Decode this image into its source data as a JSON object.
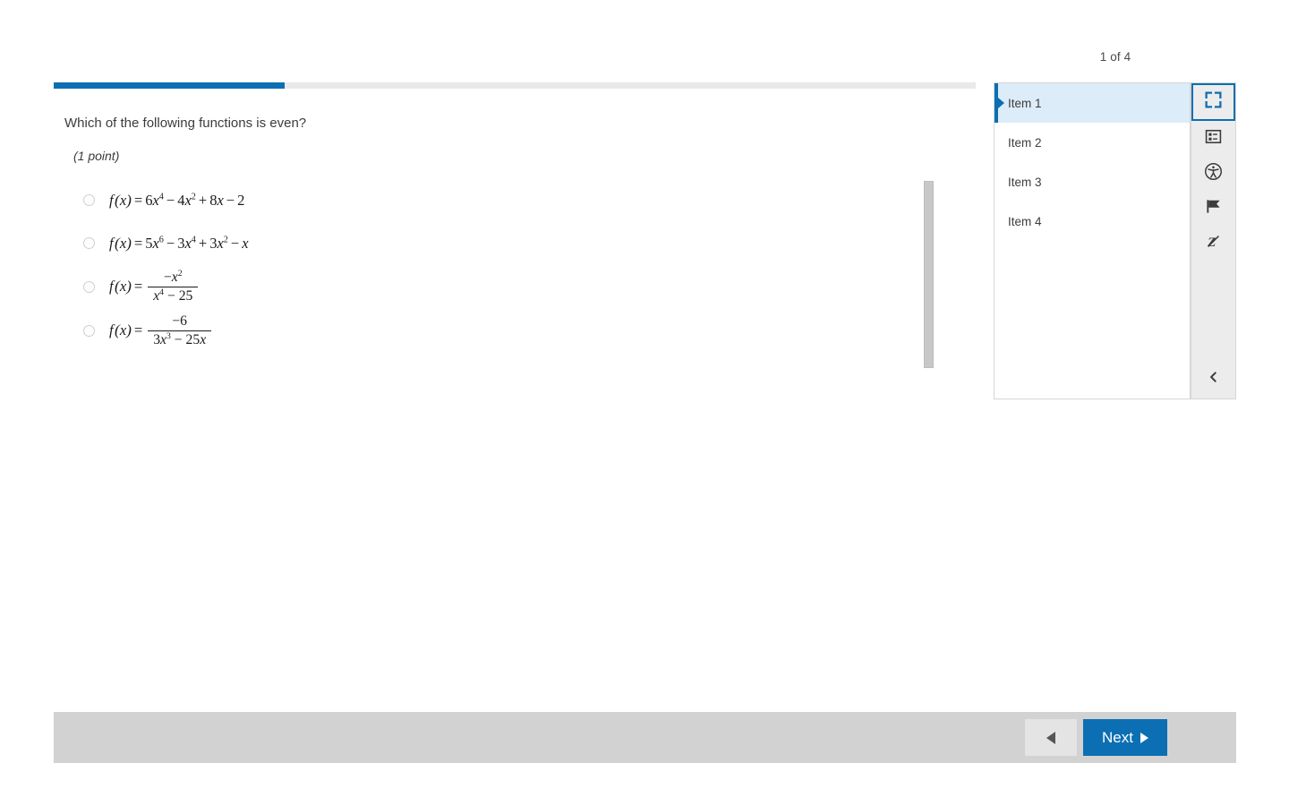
{
  "header": {
    "page_counter": "1 of 4"
  },
  "progress": {
    "percent": 25,
    "fill_color": "#0c6fb4",
    "track_color": "#e9e9e9"
  },
  "question": {
    "stem": "Which of the following functions is even?",
    "points": "(1 point)",
    "choices": [
      {
        "id": "choice-a",
        "selected": false,
        "type": "polynomial",
        "latex": "f(x) = 6x^4 - 4x^2 + 8x - 2",
        "lhs": "f",
        "arg": "(x)",
        "equals": "=",
        "terms": [
          {
            "coef": "6",
            "var": "x",
            "exp": "4"
          },
          {
            "op": "−",
            "coef": "4",
            "var": "x",
            "exp": "2"
          },
          {
            "op": "+",
            "coef": "8",
            "var": "x",
            "exp": ""
          },
          {
            "op": "−",
            "coef": "2",
            "var": "",
            "exp": ""
          }
        ]
      },
      {
        "id": "choice-b",
        "selected": false,
        "type": "polynomial",
        "latex": "f(x) = 5x^6 - 3x^4 + 3x^2 - x",
        "lhs": "f",
        "arg": "(x)",
        "equals": "=",
        "terms": [
          {
            "coef": "5",
            "var": "x",
            "exp": "6"
          },
          {
            "op": "−",
            "coef": "3",
            "var": "x",
            "exp": "4"
          },
          {
            "op": "+",
            "coef": "3",
            "var": "x",
            "exp": "2"
          },
          {
            "op": "−",
            "coef": "",
            "var": "x",
            "exp": ""
          }
        ]
      },
      {
        "id": "choice-c",
        "selected": false,
        "type": "fraction",
        "latex": "f(x) = \\frac{-x^2}{x^4 - 25}",
        "lhs": "f",
        "arg": "(x)",
        "equals": "=",
        "numerator": {
          "sign": "−",
          "var": "x",
          "exp": "2"
        },
        "denominator": {
          "var": "x",
          "exp": "4",
          "op": "−",
          "const": "25"
        }
      },
      {
        "id": "choice-d",
        "selected": false,
        "type": "fraction",
        "latex": "f(x) = \\frac{-6}{3x^3 - 25x}",
        "lhs": "f",
        "arg": "(x)",
        "equals": "=",
        "numerator": {
          "sign": "−",
          "const": "6"
        },
        "denominator": {
          "coef": "3",
          "var": "x",
          "exp": "3",
          "op": "−",
          "const2": "25",
          "var2": "x"
        }
      }
    ]
  },
  "item_panel": {
    "items": [
      {
        "label": "Item 1",
        "selected": true
      },
      {
        "label": "Item 2",
        "selected": false
      },
      {
        "label": "Item 3",
        "selected": false
      },
      {
        "label": "Item 4",
        "selected": false
      }
    ],
    "selected_accent": "#0c6fb4",
    "selected_background": "#dcecf8"
  },
  "icon_rail": {
    "buttons": [
      {
        "name": "fullscreen-icon",
        "active": true
      },
      {
        "name": "item-list-icon",
        "active": false
      },
      {
        "name": "accessibility-icon",
        "active": false
      },
      {
        "name": "flag-icon",
        "active": false
      },
      {
        "name": "strikethrough-icon",
        "active": false
      }
    ],
    "collapse": {
      "name": "chevron-left-icon"
    }
  },
  "footer": {
    "previous_label": "",
    "next_label": "Next",
    "next_color": "#0c6fb4"
  }
}
